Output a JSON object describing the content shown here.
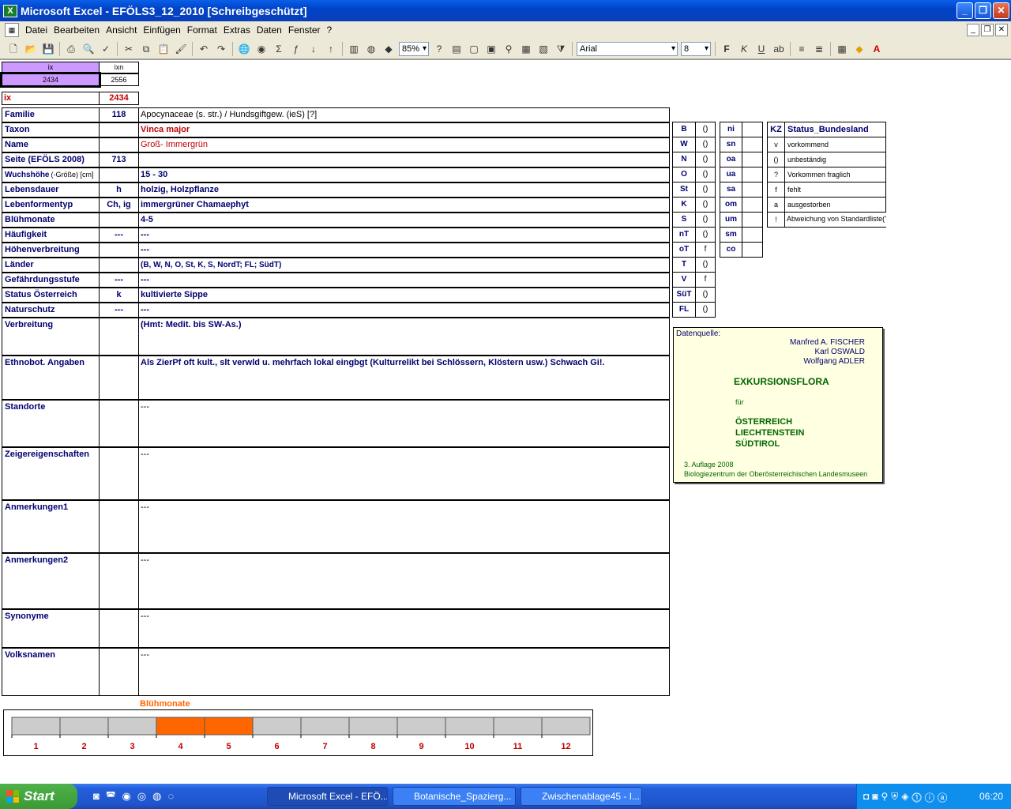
{
  "window": {
    "title": "Microsoft Excel - EFÖLS3_12_2010  [Schreibgeschützt]",
    "app_icon": "excel-icon"
  },
  "menu": [
    "Datei",
    "Bearbeiten",
    "Ansicht",
    "Einfügen",
    "Format",
    "Extras",
    "Daten",
    "Fenster",
    "?"
  ],
  "toolbar": {
    "zoom": "85%",
    "font": "Arial",
    "size": "8"
  },
  "index": {
    "h1": "ix",
    "h2": "ixn",
    "v1": "2434",
    "v2": "2556",
    "ix_label": "ix",
    "ix_value": "2434"
  },
  "rows": [
    {
      "label": "Familie",
      "code": "118",
      "value": "Apocynaceae (s. str.)  /  Hundsgiftgew. (ieS) [?]"
    },
    {
      "label": "Taxon",
      "code": "",
      "value": "Vinca major"
    },
    {
      "label": "Name",
      "code": "",
      "value": "Groß- Immergrün"
    },
    {
      "label": "Seite (EFÖLS 2008)",
      "code": "713",
      "value": ""
    },
    {
      "label": "Wuchshöhe",
      "label_suffix": "(-Größe) [cm]",
      "code": "",
      "value": "15 - 30"
    },
    {
      "label": "Lebensdauer",
      "code": "h",
      "value": "holzig, Holzpflanze"
    },
    {
      "label": "Lebenformentyp",
      "code": "Ch, ig",
      "value": "immergrüner Chamaephyt"
    },
    {
      "label": "Blühmonate",
      "code": "",
      "value": "4-5"
    },
    {
      "label": "Häufigkeit",
      "code": "---",
      "value": "---"
    },
    {
      "label": "Höhenverbreitung",
      "code": "",
      "value": "---"
    },
    {
      "label": "Länder",
      "code": "",
      "value": "(B, W, N, O, St, K, S, NordT; FL; SüdT)"
    },
    {
      "label": "Gefährdungsstufe",
      "code": "---",
      "value": "---"
    },
    {
      "label": "Status Österreich",
      "code": "k",
      "value": "kultivierte Sippe"
    },
    {
      "label": "Naturschutz",
      "code": "---",
      "value": "---"
    },
    {
      "label": "Verbreitung",
      "code": "",
      "value": "(Hmt: Medit. bis SW-As.)"
    },
    {
      "label": "Ethnobot. Angaben",
      "code": "",
      "value": "Als ZierPf oft kult., slt verwld u. mehrfach lokal eingbgt (Kulturrelikt bei Schlössern, Klöstern usw.) Schwach Gi!."
    },
    {
      "label": "Standorte",
      "code": "",
      "value": "---"
    },
    {
      "label": "Zeigereigenschaften",
      "code": "",
      "value": "---"
    },
    {
      "label": "Anmerkungen1",
      "code": "",
      "value": "---"
    },
    {
      "label": "Anmerkungen2",
      "code": "",
      "value": "---"
    },
    {
      "label": "Synonyme",
      "code": "",
      "value": "---"
    },
    {
      "label": "Volksnamen",
      "code": "",
      "value": "---"
    }
  ],
  "states": [
    {
      "k": "B",
      "v": "()"
    },
    {
      "k": "W",
      "v": "()"
    },
    {
      "k": "N",
      "v": "()"
    },
    {
      "k": "O",
      "v": "()"
    },
    {
      "k": "St",
      "v": "()"
    },
    {
      "k": "K",
      "v": "()"
    },
    {
      "k": "S",
      "v": "()"
    },
    {
      "k": "nT",
      "v": "()"
    },
    {
      "k": "oT",
      "v": "f"
    },
    {
      "k": "T",
      "v": "()"
    },
    {
      "k": "V",
      "v": "f"
    },
    {
      "k": "SüT",
      "v": "()"
    },
    {
      "k": "FL",
      "v": "()"
    }
  ],
  "altitude": [
    "ni",
    "sn",
    "oa",
    "ua",
    "sa",
    "om",
    "um",
    "sm",
    "co"
  ],
  "legend": {
    "head_k": "KZ",
    "head_v": "Status_Bundesland",
    "items": [
      {
        "k": "v",
        "v": "vorkommend"
      },
      {
        "k": "()",
        "v": "unbeständig"
      },
      {
        "k": "?",
        "v": "Vorkommen fraglich"
      },
      {
        "k": "f",
        "v": "fehlt"
      },
      {
        "k": "a",
        "v": "ausgestorben"
      },
      {
        "k": "!",
        "v": "Abweichung von Standardliste(?)"
      }
    ]
  },
  "source": {
    "label": "Datenquelle:",
    "authors": [
      "Manfred A. FISCHER",
      "Karl OSWALD",
      "Wolfgang ADLER"
    ],
    "title": "EXKURSIONSFLORA",
    "fuer": "für",
    "regions": [
      "ÖSTERREICH",
      "LIECHTENSTEIN",
      "SÜDTIROL"
    ],
    "edition": "3. Auflage 2008",
    "publisher": "Biologiezentrum der Oberösterreichischen Landesmuseen"
  },
  "chart_data": {
    "type": "bar",
    "title": "Blühmonate",
    "categories": [
      "1",
      "2",
      "3",
      "4",
      "5",
      "6",
      "7",
      "8",
      "9",
      "10",
      "11",
      "12"
    ],
    "values": [
      0,
      0,
      0,
      1,
      1,
      0,
      0,
      0,
      0,
      0,
      0,
      0
    ],
    "colors": {
      "on": "#ff6600",
      "off": "#cccccc"
    }
  },
  "taskbar": {
    "start": "Start",
    "tasks": [
      "Microsoft Excel - EFÖ...",
      "Botanische_Spazierg...",
      "Zwischenablage45 - I..."
    ],
    "clock": "06:20"
  }
}
